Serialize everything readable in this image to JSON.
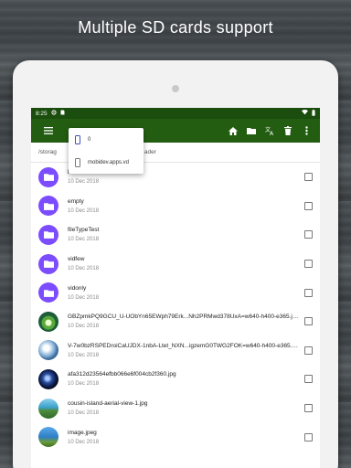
{
  "headline": "Multiple SD cards support",
  "status": {
    "time": "8:25",
    "icons": [
      "settings-icon",
      "sim-icon",
      "battery-icon"
    ]
  },
  "toolbar": {
    "menu_icon": "hamburger-menu-icon",
    "actions": [
      "home-icon",
      "folder-icon",
      "translate-icon",
      "delete-icon",
      "more-vert-icon"
    ]
  },
  "path": {
    "left": "/storag",
    "right": "ader"
  },
  "storage_menu": {
    "items": [
      {
        "label": "0",
        "icon": "phone-icon",
        "selected": true
      },
      {
        "label": "mobidev.apps.vd",
        "icon": "sd-card-icon",
        "selected": false
      }
    ]
  },
  "files": [
    {
      "name": "best",
      "date": "10 Dec 2018",
      "kind": "folder"
    },
    {
      "name": "empty",
      "date": "10 Dec 2018",
      "kind": "folder"
    },
    {
      "name": "fileTypeTest",
      "date": "10 Dec 2018",
      "kind": "folder"
    },
    {
      "name": "vidfew",
      "date": "10 Dec 2018",
      "kind": "folder"
    },
    {
      "name": "vidonly",
      "date": "10 Dec 2018",
      "kind": "folder"
    },
    {
      "name": "GBZpmkPQ9GCU_U-UObYn65EWph79Erk...Nh2PRMwd378UxA=w640-h400-e365.jpeg",
      "date": "10 Dec 2018",
      "kind": "image"
    },
    {
      "name": "V-7w0bzRSPEDroiCaUJDX-1nbA-Ltet_NXN...igzemG0TWG2FOK=w640-h400-e365.jpeg",
      "date": "10 Dec 2018",
      "kind": "image"
    },
    {
      "name": "afa312d23564efbb066e6f004cb2f360.jpg",
      "date": "10 Dec 2018",
      "kind": "image"
    },
    {
      "name": "cousin-island-aerial-view-1.jpg",
      "date": "10 Dec 2018",
      "kind": "image"
    },
    {
      "name": "image.jpeg",
      "date": "10 Dec 2018",
      "kind": "image"
    }
  ],
  "colors": {
    "appbar": "#235d12",
    "statusbar": "#1b4d0e",
    "folder": "#7c4dff",
    "accent": "#3f51b5"
  }
}
